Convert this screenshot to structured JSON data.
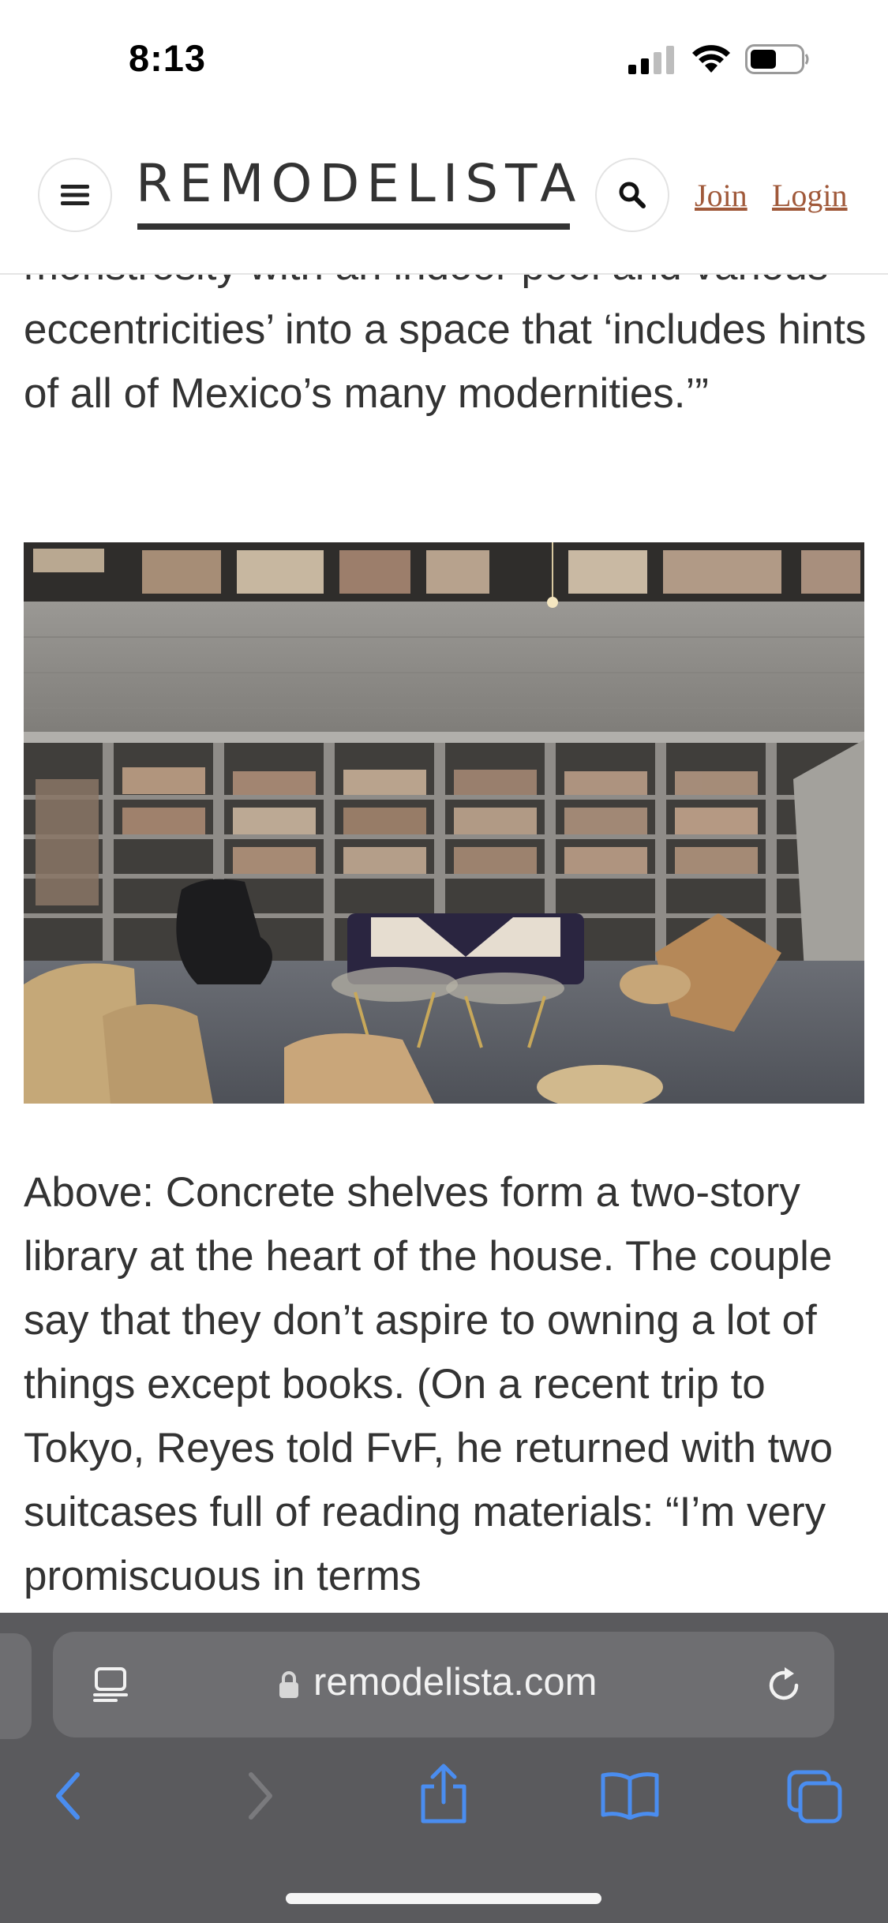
{
  "status_bar": {
    "time": "8:13"
  },
  "header": {
    "logo": "REMODELISTA",
    "join_label": "Join",
    "login_label": "Login"
  },
  "article": {
    "paragraph_top": "monstrosity with an indoor pool and various eccentricities’ into a space that ‘includes hints of all of Mexico’s many modernities.’”",
    "paragraph_bottom": "Above: Concrete shelves form a two-story library at the heart of the house. The couple say that they don’t aspire to owning a lot of things except books. (On a recent trip to Tokyo, Reyes told FvF, he returned with two suitcases full of reading materials: “I’m very promiscuous in terms"
  },
  "browser": {
    "url": "remodelista.com",
    "icons": [
      "reader-icon",
      "lock-icon",
      "reload-icon",
      "back-icon",
      "forward-icon",
      "share-icon",
      "bookmarks-icon",
      "tabs-icon"
    ]
  },
  "colors": {
    "link": "#a0593a",
    "text": "#333333",
    "browser_bg": "#5a5a5d",
    "toolbar_accent": "#4a8df0"
  }
}
